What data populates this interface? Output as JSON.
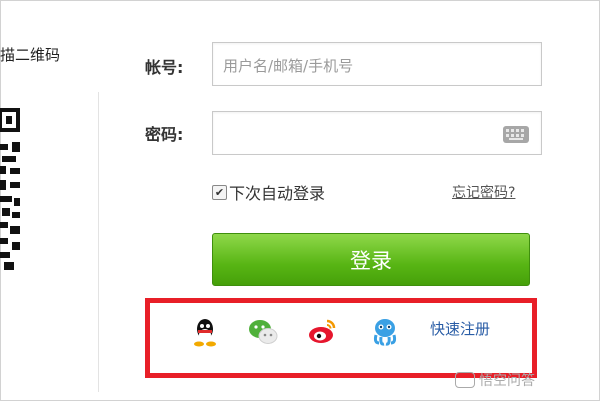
{
  "qr_section": {
    "label": "描二维码"
  },
  "form": {
    "account_label": "帐号:",
    "account_placeholder": "用户名/邮箱/手机号",
    "password_label": "密码:",
    "password_value": "",
    "auto_login_label": "下次自动登录",
    "auto_login_checked": true,
    "forgot_link": "忘记密码?",
    "login_button": "登录"
  },
  "social": {
    "icons": [
      "qq-icon",
      "wechat-icon",
      "weibo-icon",
      "tencent-weibo-icon"
    ],
    "register_link": "快速注册"
  },
  "watermark": {
    "text": "悟空问答"
  },
  "colors": {
    "login_green": "#58b514",
    "highlight_red": "#e81f28",
    "link_blue": "#2a5da6"
  }
}
